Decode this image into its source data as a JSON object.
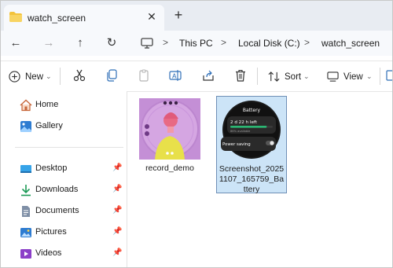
{
  "window": {
    "tab_title": "watch_screen",
    "icons": {
      "folder": "folder-icon",
      "close": "close-icon",
      "new_tab": "plus-icon"
    }
  },
  "navigation": {
    "back": "arrow-left-icon",
    "forward": "arrow-right-icon",
    "up": "arrow-up-icon",
    "refresh": "refresh-icon",
    "breadcrumbs": [
      "This PC",
      "Local Disk (C:)",
      "watch_screen"
    ]
  },
  "toolbar": {
    "new_label": "New",
    "sort_label": "Sort",
    "view_label": "View",
    "icons": [
      "cut-icon",
      "copy-icon",
      "paste-icon",
      "rename-icon",
      "share-icon",
      "delete-icon"
    ]
  },
  "sidebar": {
    "items": [
      {
        "label": "Home",
        "icon": "home-icon",
        "pinned": false
      },
      {
        "label": "Gallery",
        "icon": "gallery-icon",
        "pinned": false
      },
      {
        "label": "Desktop",
        "icon": "desktop-icon",
        "pinned": true
      },
      {
        "label": "Downloads",
        "icon": "download-icon",
        "pinned": true
      },
      {
        "label": "Documents",
        "icon": "documents-icon",
        "pinned": true
      },
      {
        "label": "Pictures",
        "icon": "pictures-icon",
        "pinned": true
      },
      {
        "label": "Videos",
        "icon": "videos-icon",
        "pinned": true
      }
    ]
  },
  "files": [
    {
      "name": "record_demo",
      "selected": false,
      "thumb": "video-thumbnail"
    },
    {
      "name": "Screenshot_20251107_165759_Battery",
      "selected": true,
      "thumb": "watch-battery-thumbnail",
      "thumb_text": {
        "title": "Battery",
        "time_left": "2 d 22 h left",
        "available": "86% available",
        "power_saving": "Power saving"
      },
      "battery_fraction": 0.86
    }
  ],
  "colors": {
    "accent": "#0067c0",
    "selection": "#cce4f7",
    "folder": "#f3c33c"
  }
}
